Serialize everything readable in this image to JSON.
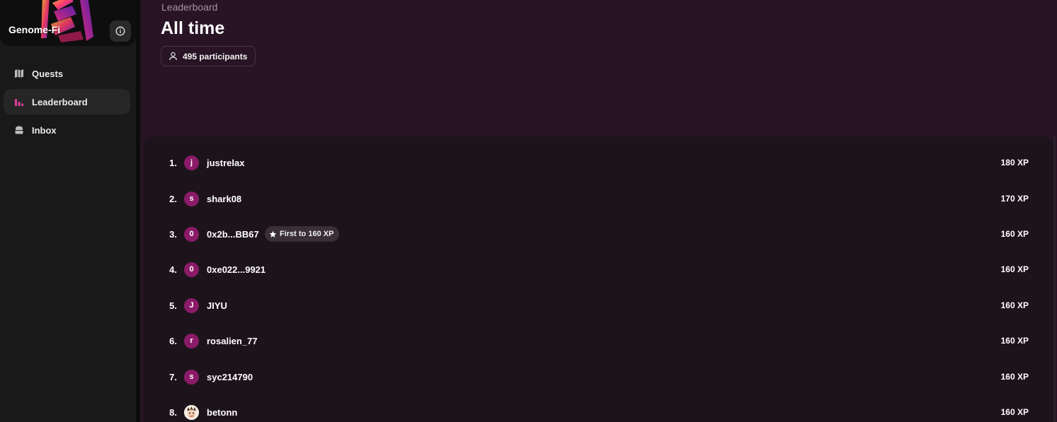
{
  "sidebar": {
    "brand_name": "Genome-Fi",
    "nav": [
      {
        "label": "Quests",
        "icon": "map-icon",
        "active": false
      },
      {
        "label": "Leaderboard",
        "icon": "bar-chart-icon",
        "active": true
      },
      {
        "label": "Inbox",
        "icon": "inbox-icon",
        "active": false
      }
    ]
  },
  "header": {
    "breadcrumb": "Leaderboard",
    "title": "All time",
    "participants": "495 participants"
  },
  "leaderboard": {
    "rows": [
      {
        "rank": "1.",
        "avatar": "j",
        "name": "justrelax",
        "xp": "180 XP"
      },
      {
        "rank": "2.",
        "avatar": "s",
        "name": "shark08",
        "xp": "170 XP"
      },
      {
        "rank": "3.",
        "avatar": "0",
        "name": "0x2b...BB67",
        "badge": "First to 160 XP",
        "xp": "160 XP"
      },
      {
        "rank": "4.",
        "avatar": "0",
        "name": "0xe022...9921",
        "xp": "160 XP"
      },
      {
        "rank": "5.",
        "avatar": "J",
        "name": "JIYU",
        "xp": "160 XP"
      },
      {
        "rank": "6.",
        "avatar": "r",
        "name": "rosalien_77",
        "xp": "160 XP"
      },
      {
        "rank": "7.",
        "avatar": "s",
        "name": "syc214790",
        "xp": "160 XP"
      },
      {
        "rank": "8.",
        "avatar": "",
        "name": "betonn",
        "xp": "160 XP"
      }
    ]
  },
  "colors": {
    "main_bg": "#281425",
    "board_bg": "#1d141b",
    "sidebar_bg": "#191919",
    "accent": "#8b1b68",
    "active_icon": "#e0409c"
  }
}
